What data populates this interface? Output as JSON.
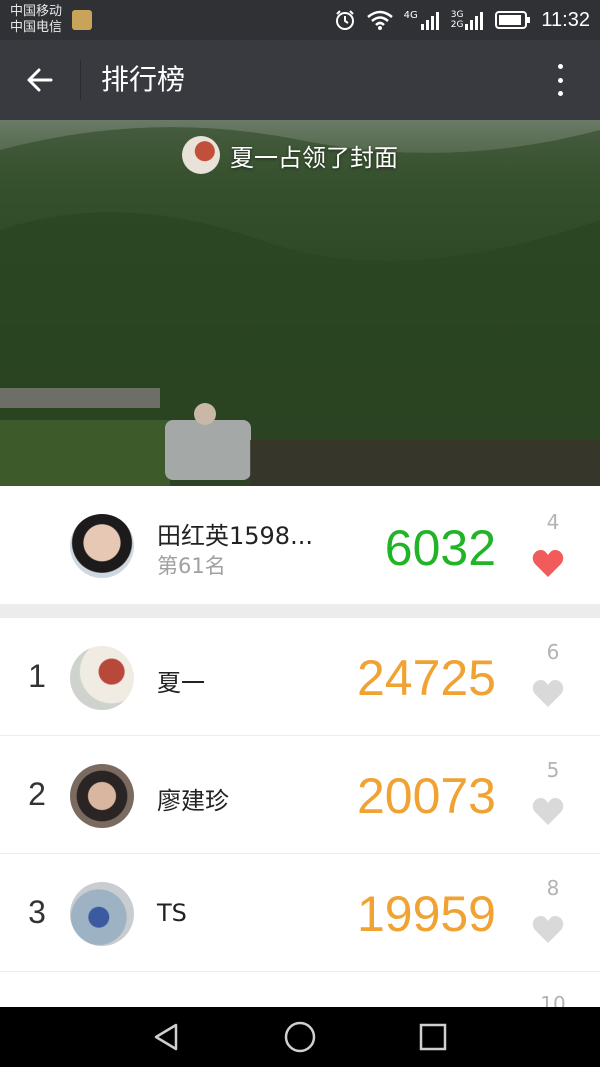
{
  "status_bar": {
    "carrier_1": "中国移动",
    "carrier_2": "中国电信",
    "network_1": "4G",
    "network_2": "3G",
    "network_3": "2G",
    "time": "11:32"
  },
  "toolbar": {
    "title": "排行榜",
    "back_icon": "arrow-left-icon",
    "more_icon": "more-vertical-icon"
  },
  "cover": {
    "caption": "夏一占领了封面"
  },
  "me": {
    "name": "田红英1598...",
    "rank_text": "第61名",
    "steps": "6032",
    "likes": "4",
    "liked": true
  },
  "ranking": [
    {
      "rank": "1",
      "name": "夏一",
      "steps": "24725",
      "likes": "6"
    },
    {
      "rank": "2",
      "name": "廖建珍",
      "steps": "20073",
      "likes": "5"
    },
    {
      "rank": "3",
      "name": "TS",
      "steps": "19959",
      "likes": "8"
    }
  ],
  "partial_row": {
    "likes": "10"
  },
  "colors": {
    "my_steps": "#21b426",
    "rank_steps": "#f0a233",
    "heart_active": "#f25b5b",
    "heart_inactive": "#d9d9d9",
    "toolbar": "#393a3f"
  }
}
